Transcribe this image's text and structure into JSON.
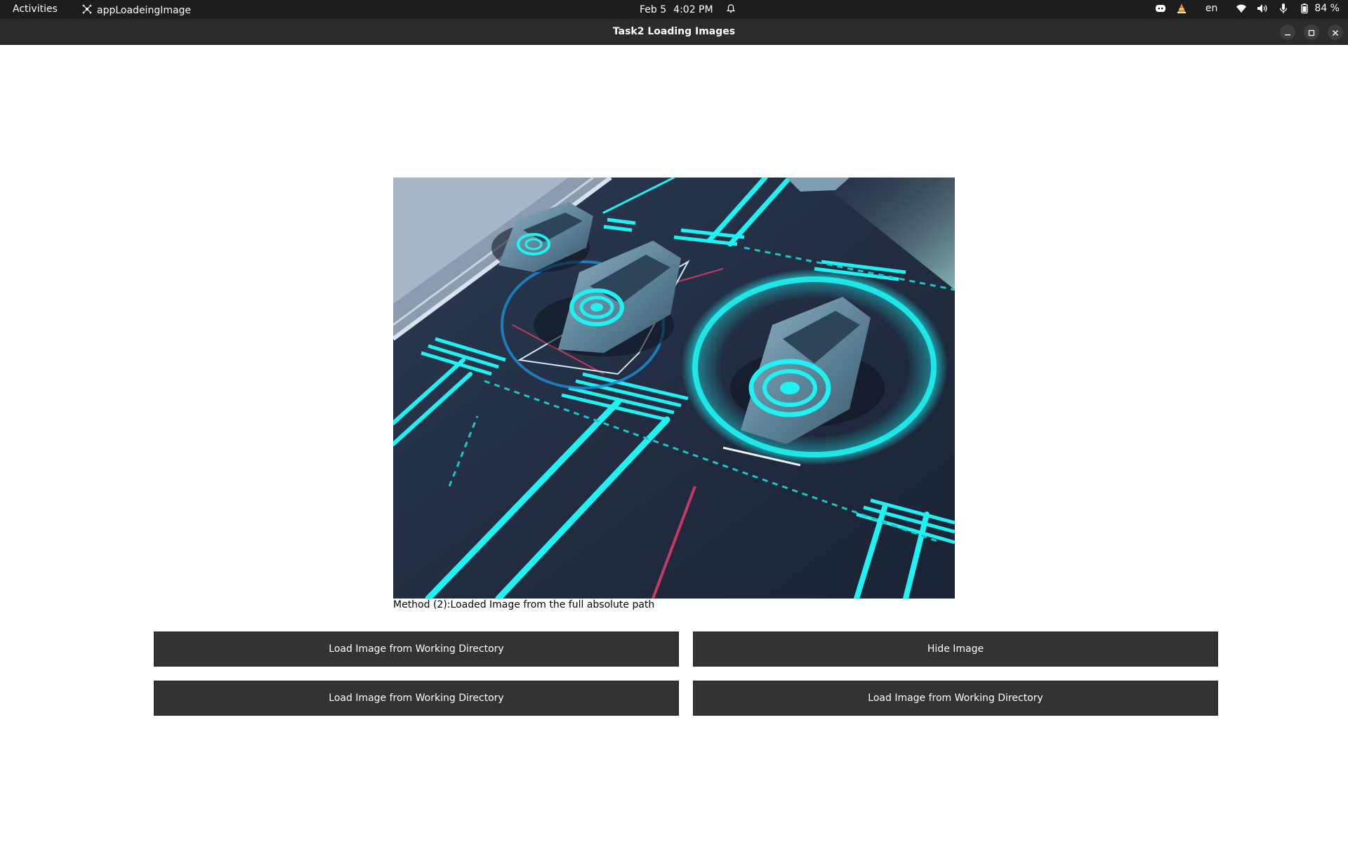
{
  "topbar": {
    "activities": "Activities",
    "app_name": "appLoadeingImage",
    "date": "Feb 5",
    "time": "4:02 PM",
    "language": "en",
    "battery": "84 %",
    "icons": [
      "app-indicator-icon",
      "alarm-icon",
      "discord-icon",
      "vlc-icon",
      "wifi-icon",
      "volume-icon",
      "microphone-icon",
      "battery-icon"
    ]
  },
  "window": {
    "title": "Task2 Loading Images",
    "controls": [
      "minimize-icon",
      "maximize-icon",
      "close-icon"
    ]
  },
  "main": {
    "image_subject": "autonomous cars on a smart road with glowing cyan sensor rings",
    "caption": "Method (2):Loaded Image from the full absolute path",
    "buttons": {
      "top_left": "Load Image from Working Directory",
      "top_right": "Hide Image",
      "bottom_left": "Load Image from Working Directory",
      "bottom_right": "Load Image from Working Directory"
    }
  },
  "colors": {
    "topbar_bg": "#1d1d1d",
    "titlebar_bg": "#2b2b2b",
    "button_bg": "#333333",
    "neon_cyan": "#1ef2f2"
  }
}
